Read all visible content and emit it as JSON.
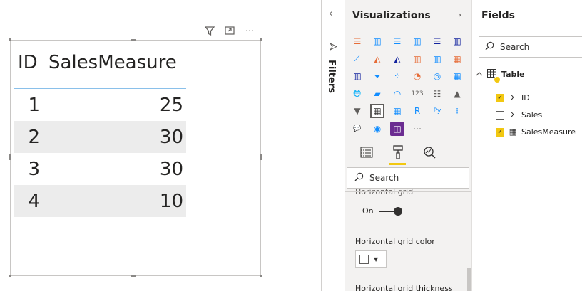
{
  "visual": {
    "header_icons": [
      "filter-icon",
      "focus-mode-icon",
      "more-options-icon"
    ],
    "more_glyph": "⋯",
    "table": {
      "columns": [
        "ID",
        "SalesMeasure"
      ],
      "rows": [
        [
          "1",
          "25"
        ],
        [
          "2",
          "30"
        ],
        [
          "3",
          "30"
        ],
        [
          "4",
          "10"
        ]
      ]
    }
  },
  "filters": {
    "label": "Filters",
    "collapse_glyph": "‹"
  },
  "visualizations": {
    "title": "Visualizations",
    "expand_glyph": "›",
    "icons": [
      {
        "name": "stacked-bar-chart-icon",
        "glyph": "☰",
        "color": "#e66c37"
      },
      {
        "name": "stacked-column-chart-icon",
        "glyph": "▥",
        "color": "#118dff"
      },
      {
        "name": "clustered-bar-chart-icon",
        "glyph": "☰",
        "color": "#118dff"
      },
      {
        "name": "clustered-column-chart-icon",
        "glyph": "▥",
        "color": "#118dff"
      },
      {
        "name": "100-stacked-bar-chart-icon",
        "glyph": "☰",
        "color": "#12239e"
      },
      {
        "name": "100-stacked-column-chart-icon",
        "glyph": "▥",
        "color": "#12239e"
      },
      {
        "name": "line-chart-icon",
        "glyph": "⟋",
        "color": "#118dff"
      },
      {
        "name": "area-chart-icon",
        "glyph": "◭",
        "color": "#e66c37"
      },
      {
        "name": "stacked-area-chart-icon",
        "glyph": "◭",
        "color": "#12239e"
      },
      {
        "name": "line-and-stacked-column-icon",
        "glyph": "▥",
        "color": "#e66c37"
      },
      {
        "name": "line-and-clustered-column-icon",
        "glyph": "▥",
        "color": "#118dff"
      },
      {
        "name": "ribbon-chart-icon",
        "glyph": "▦",
        "color": "#e66c37"
      },
      {
        "name": "waterfall-chart-icon",
        "glyph": "▥",
        "color": "#12239e"
      },
      {
        "name": "funnel-chart-icon",
        "glyph": "⏷",
        "color": "#118dff"
      },
      {
        "name": "scatter-chart-icon",
        "glyph": "⁘",
        "color": "#118dff"
      },
      {
        "name": "pie-chart-icon",
        "glyph": "◔",
        "color": "#e66c37"
      },
      {
        "name": "donut-chart-icon",
        "glyph": "◎",
        "color": "#118dff"
      },
      {
        "name": "treemap-icon",
        "glyph": "▦",
        "color": "#118dff"
      },
      {
        "name": "map-icon",
        "glyph": "🌐",
        "color": "#118dff"
      },
      {
        "name": "filled-map-icon",
        "glyph": "▰",
        "color": "#118dff"
      },
      {
        "name": "gauge-icon",
        "glyph": "◠",
        "color": "#118dff"
      },
      {
        "name": "card-icon",
        "glyph": "123",
        "color": "#605e5c"
      },
      {
        "name": "multi-row-card-icon",
        "glyph": "☷",
        "color": "#605e5c"
      },
      {
        "name": "kpi-icon",
        "glyph": "▲",
        "color": "#605e5c"
      },
      {
        "name": "slicer-icon",
        "glyph": "▼",
        "color": "#605e5c"
      },
      {
        "name": "table-icon",
        "glyph": "▦",
        "color": "#323130"
      },
      {
        "name": "matrix-icon",
        "glyph": "▦",
        "color": "#118dff"
      },
      {
        "name": "r-visual-icon",
        "glyph": "R",
        "color": "#118dff"
      },
      {
        "name": "python-visual-icon",
        "glyph": "Py",
        "color": "#118dff"
      },
      {
        "name": "key-influencers-icon",
        "glyph": "⁝",
        "color": "#118dff"
      },
      {
        "name": "qa-icon",
        "glyph": "💬",
        "color": "#605e5c"
      },
      {
        "name": "arcgis-map-icon",
        "glyph": "◉",
        "color": "#118dff"
      },
      {
        "name": "custom-visual-icon",
        "glyph": "◫",
        "color": "#ffffff"
      },
      {
        "name": "more-visuals-icon",
        "glyph": "⋯",
        "color": "#323130"
      }
    ],
    "tabs": [
      "fields-tab-icon",
      "format-tab-icon",
      "analytics-tab-icon"
    ],
    "search_placeholder": "Search",
    "cutoff_text": "Horizontal grid",
    "toggle_label": "On",
    "horizontal_grid_color_label": "Horizontal grid color",
    "horizontal_grid_thickness_label": "Horizontal grid thickness"
  },
  "fields": {
    "title": "Fields",
    "search_placeholder": "Search",
    "table_name": "Table",
    "items": [
      {
        "label": "ID",
        "checked": true,
        "icon": "Σ"
      },
      {
        "label": "Sales",
        "checked": false,
        "icon": "Σ"
      },
      {
        "label": "SalesMeasure",
        "checked": true,
        "icon": "▦"
      }
    ]
  }
}
